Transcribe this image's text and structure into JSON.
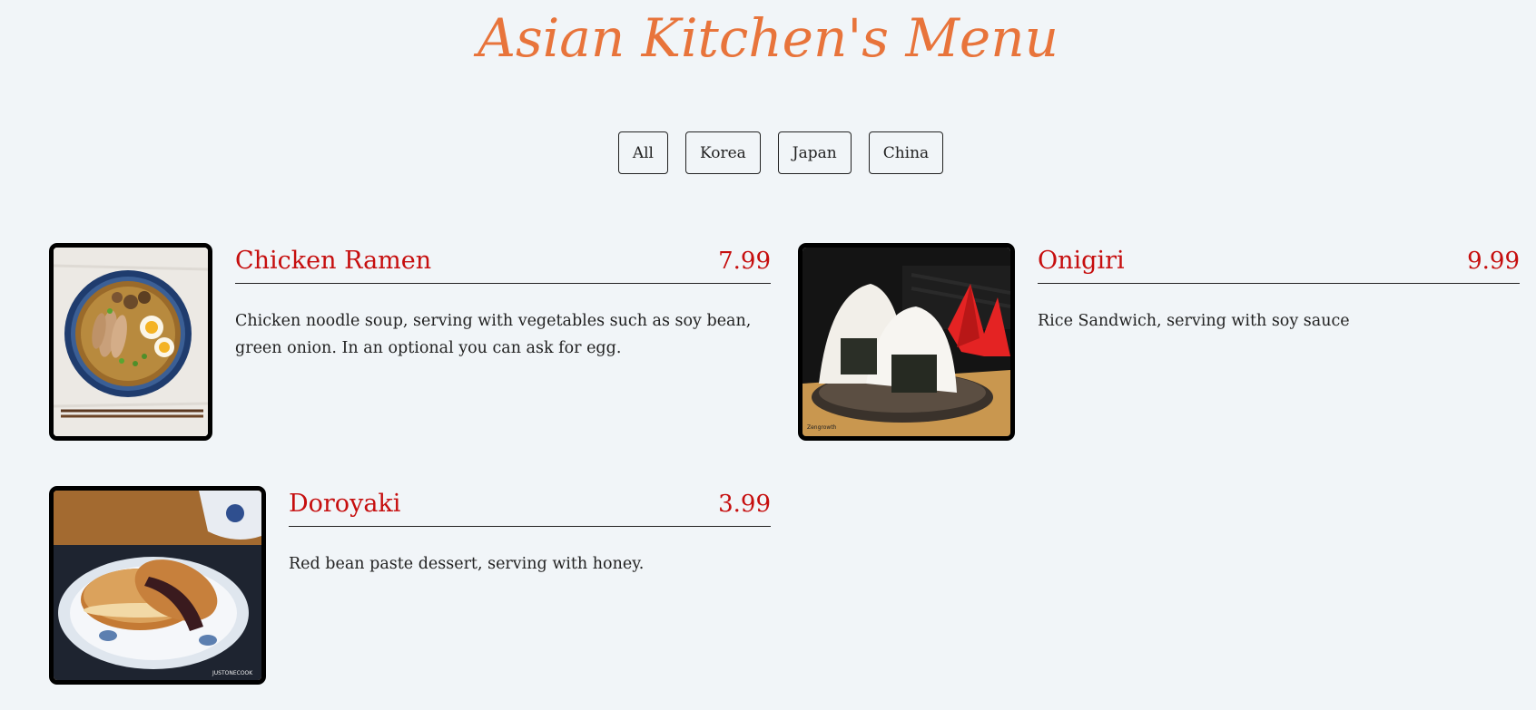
{
  "header": {
    "title": "Asian Kitchen's Menu"
  },
  "filters": {
    "all": "All",
    "korea": "Korea",
    "japan": "Japan",
    "china": "China"
  },
  "items": [
    {
      "name": "Chicken Ramen",
      "price": "7.99",
      "description": "Chicken noodle soup, serving with vegetables such as soy bean, green onion. In an optional you can ask for egg."
    },
    {
      "name": "Onigiri",
      "price": "9.99",
      "description": "Rice Sandwich, serving with soy sauce"
    },
    {
      "name": "Doroyaki",
      "price": "3.99",
      "description": "Red bean paste dessert, serving with honey."
    }
  ],
  "colors": {
    "title": "#e8743b",
    "item_name": "#c60e0e",
    "background": "#f1f5f8"
  }
}
